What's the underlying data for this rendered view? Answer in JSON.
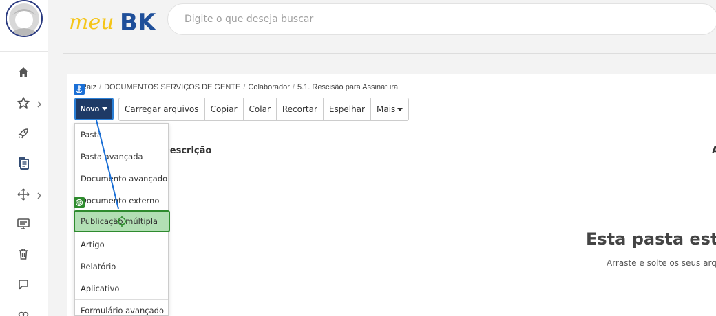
{
  "header": {
    "logo_prefix": "meu",
    "logo_suffix": "BK",
    "search_placeholder": "Digite o que deseja buscar"
  },
  "sidebar": {
    "items": [
      {
        "icon": "home-icon"
      },
      {
        "icon": "star-icon",
        "has_submenu": true
      },
      {
        "icon": "rocket-icon"
      },
      {
        "icon": "documents-icon"
      },
      {
        "icon": "arrows-move-icon",
        "has_submenu": true
      },
      {
        "icon": "presentation-icon"
      },
      {
        "icon": "trash-icon"
      },
      {
        "icon": "chat-icon"
      },
      {
        "icon": "link-icon"
      }
    ]
  },
  "breadcrumb": [
    "Raiz",
    "DOCUMENTOS SERVIÇOS DE GENTE",
    "Colaborador",
    "5.1. Rescisão para Assinatura"
  ],
  "toolbar": {
    "new_label": "Novo",
    "buttons": [
      "Carregar arquivos",
      "Copiar",
      "Colar",
      "Recortar",
      "Espelhar",
      "Mais"
    ]
  },
  "table": {
    "column_description": "Descrição",
    "column_right_partial": "A"
  },
  "empty_state": {
    "title": "Esta pasta est",
    "subtitle": "Arraste e solte os seus arq"
  },
  "dropdown": {
    "items": [
      "Pasta",
      "Pasta avançada",
      "Documento avançado",
      "Documento externo",
      "Publicação múltipla",
      "Artigo",
      "Relatório",
      "Aplicativo",
      "Formulário avançado"
    ],
    "highlighted": "Publicação múltipla"
  },
  "colors": {
    "brand_blue": "#1e3a66",
    "logo_yellow": "#f5c518",
    "logo_blue": "#1f4f9a",
    "highlight_green": "#b2dfb4",
    "highlight_border": "#2e8b2e",
    "annotation_blue": "#1a6fd6"
  }
}
